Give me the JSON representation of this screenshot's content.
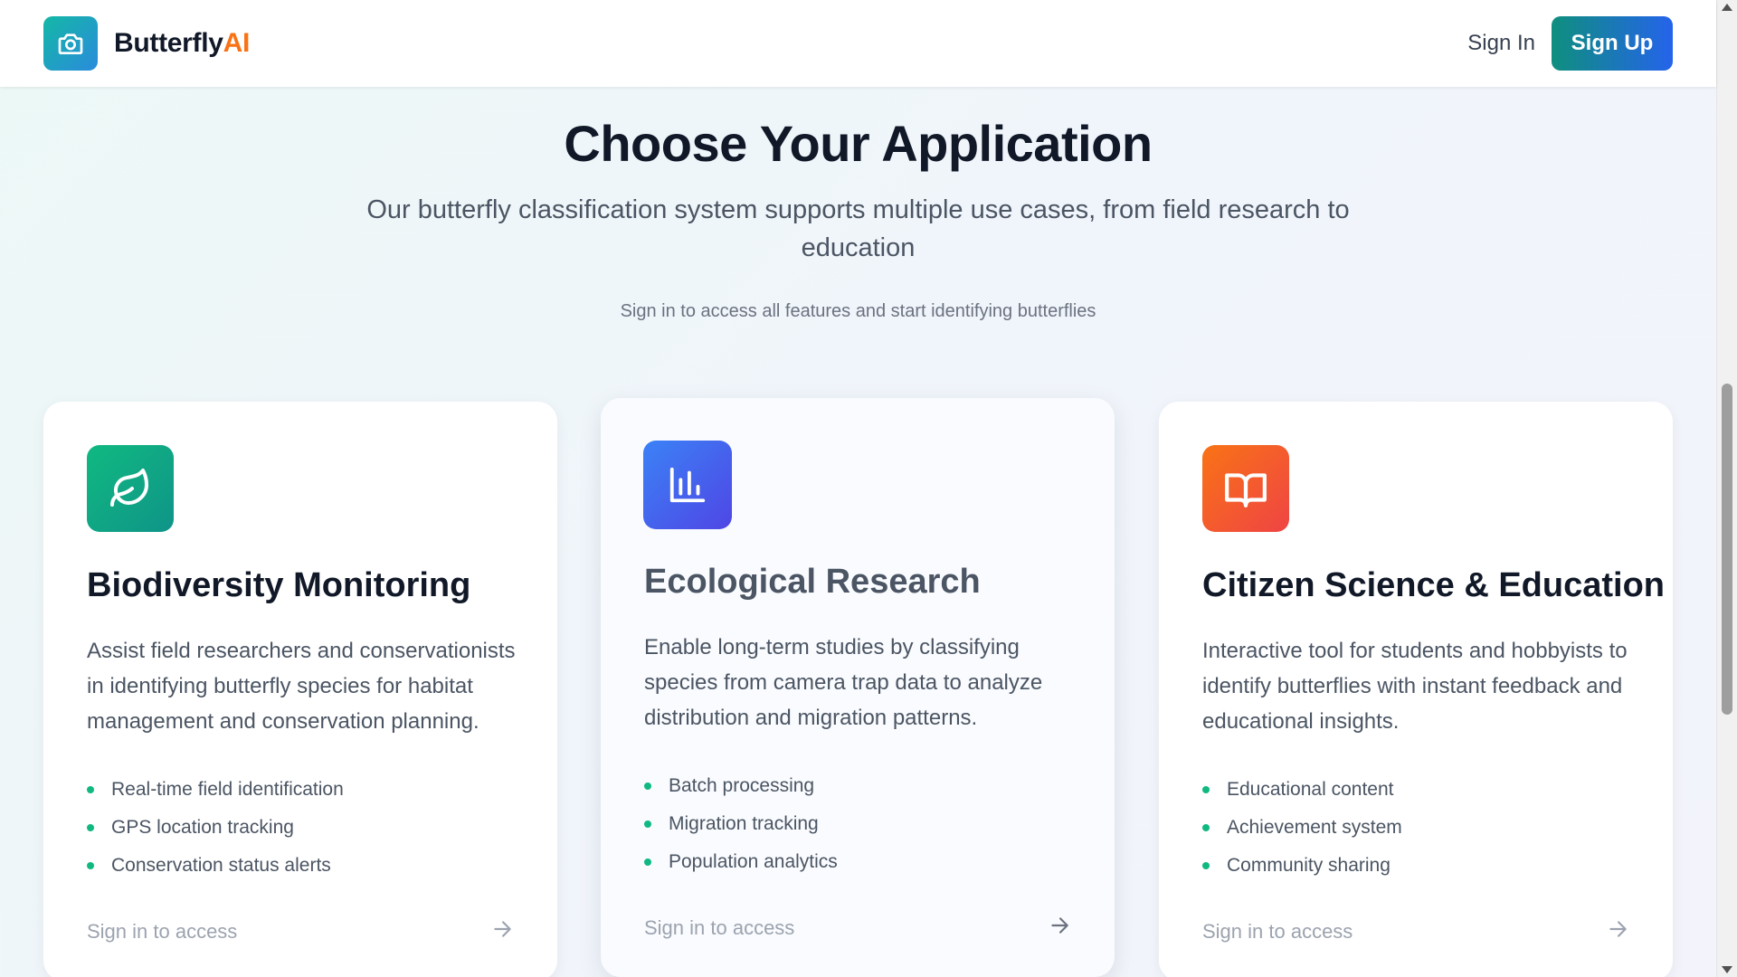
{
  "header": {
    "brand_name": "Butterfly",
    "brand_accent": "AI",
    "logo_icon": "camera-icon",
    "sign_in_label": "Sign In",
    "sign_up_label": "Sign Up"
  },
  "hero": {
    "title": "Choose Your Application",
    "subtitle": "Our butterfly classification system supports multiple use cases, from field research to education",
    "note": "Sign in to access all features and start identifying butterflies"
  },
  "cards": [
    {
      "icon": "leaf-icon",
      "title": "Biodiversity Monitoring",
      "description": "Assist field researchers and conservationists in identifying butterfly species for habitat management and conservation planning.",
      "features": [
        "Real-time field identification",
        "GPS location tracking",
        "Conservation status alerts"
      ],
      "footer": "Sign in to access"
    },
    {
      "icon": "bar-chart-icon",
      "title": "Ecological Research",
      "description": "Enable long-term studies by classifying species from camera trap data to analyze distribution and migration patterns.",
      "features": [
        "Batch processing",
        "Migration tracking",
        "Population analytics"
      ],
      "footer": "Sign in to access"
    },
    {
      "icon": "book-open-icon",
      "title": "Citizen Science & Education",
      "description": "Interactive tool for students and hobbyists to identify butterflies with instant feedback and educational insights.",
      "features": [
        "Educational content",
        "Achievement system",
        "Community sharing"
      ],
      "footer": "Sign in to access"
    }
  ],
  "colors": {
    "accent_orange": "#f97316",
    "brand_teal": "#0f8f7e",
    "brand_blue": "#2563eb",
    "bullet_green": "#10b981"
  }
}
